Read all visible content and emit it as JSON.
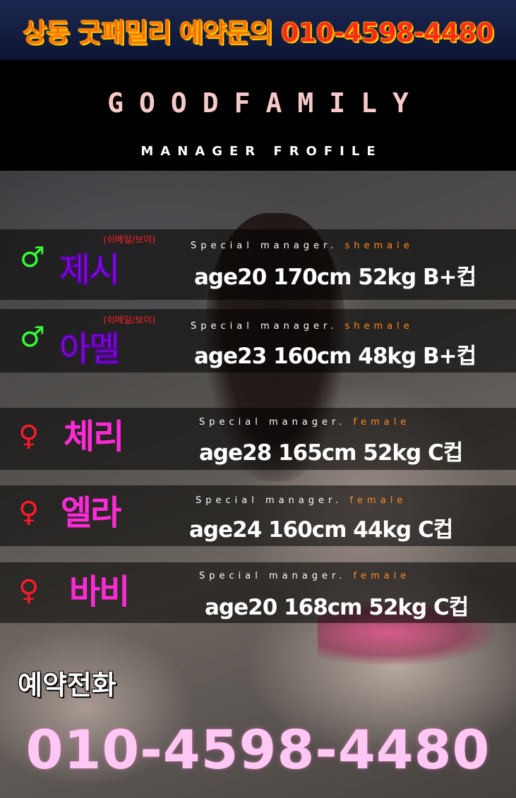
{
  "top_banner": {
    "text": "상동 굿패밀리 예약문의 010-4598-4480"
  },
  "header": {
    "brand": "GOODFAMILY",
    "subtitle": "MANAGER FROFILE"
  },
  "profiles": [
    {
      "gender_symbol": "♂",
      "tag": "(쉬메일/보이)",
      "name": "제시",
      "special_prefix": "Special manager. ",
      "special_type": "shemale",
      "stats": "age20 170cm 52kg B+컵"
    },
    {
      "gender_symbol": "♂",
      "tag": "(쉬메일/보이)",
      "name": "아멜",
      "special_prefix": "Special manager. ",
      "special_type": "shemale",
      "stats": "age23 160cm 48kg B+컵"
    },
    {
      "gender_symbol": "♀",
      "tag": "",
      "name": "체리",
      "special_prefix": "Special manager. ",
      "special_type": "female",
      "stats": "age28 165cm 52kg C컵"
    },
    {
      "gender_symbol": "♀",
      "tag": "",
      "name": "엘라",
      "special_prefix": "Special manager. ",
      "special_type": "female",
      "stats": "age24 160cm 44kg C컵"
    },
    {
      "gender_symbol": "♀",
      "tag": "",
      "name": "바비",
      "special_prefix": "Special manager. ",
      "special_type": "female",
      "stats": "age20 168cm 52kg C컵"
    }
  ],
  "reservation": {
    "label": "예약전화",
    "phone": "010-4598-4480"
  }
}
